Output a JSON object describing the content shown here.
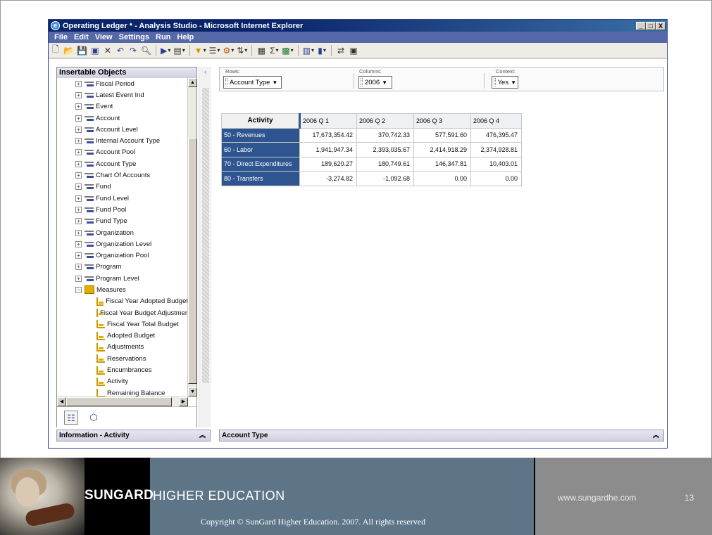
{
  "window": {
    "title": "Operating Ledger * - Analysis Studio - Microsoft Internet Explorer",
    "buttons": [
      "_",
      "□",
      "X"
    ]
  },
  "menu": [
    "File",
    "Edit",
    "View",
    "Settings",
    "Run",
    "Help"
  ],
  "toolbar_icons": [
    "new-icon",
    "open-icon",
    "save-icon",
    "save-as-icon",
    "delete-icon",
    "undo-icon",
    "redo-icon",
    "find-icon",
    "run-icon",
    "layout-icon",
    "filter-icon",
    "suppress-icon",
    "rank-icon",
    "sort-icon",
    "calculation-icon",
    "sum-icon",
    "excel-icon",
    "chart-icon",
    "bar-chart-icon",
    "swap-icon",
    "insert-icon"
  ],
  "left_panel": {
    "title": "Insertable Objects",
    "tree": [
      {
        "label": "Fiscal Period",
        "type": "dimension"
      },
      {
        "label": "Latest Event Ind",
        "type": "dimension"
      },
      {
        "label": "Event",
        "type": "dimension"
      },
      {
        "label": "Account",
        "type": "dimension"
      },
      {
        "label": "Account Level",
        "type": "dimension"
      },
      {
        "label": "Internal Account Type",
        "type": "dimension"
      },
      {
        "label": "Account Pool",
        "type": "dimension"
      },
      {
        "label": "Account Type",
        "type": "dimension"
      },
      {
        "label": "Chart Of Accounts",
        "type": "dimension"
      },
      {
        "label": "Fund",
        "type": "dimension"
      },
      {
        "label": "Fund Level",
        "type": "dimension"
      },
      {
        "label": "Fund Pool",
        "type": "dimension"
      },
      {
        "label": "Fund Type",
        "type": "dimension"
      },
      {
        "label": "Organization",
        "type": "dimension"
      },
      {
        "label": "Organization Level",
        "type": "dimension"
      },
      {
        "label": "Organization Pool",
        "type": "dimension"
      },
      {
        "label": "Program",
        "type": "dimension"
      },
      {
        "label": "Program Level",
        "type": "dimension"
      },
      {
        "label": "Measures",
        "type": "folder"
      },
      {
        "label": "Fiscal Year Adopted Budget",
        "type": "measure"
      },
      {
        "label": "Fiscal Year Budget Adjustments",
        "type": "measure"
      },
      {
        "label": "Fiscal Year Total Budget",
        "type": "measure"
      },
      {
        "label": "Adopted Budget",
        "type": "measure"
      },
      {
        "label": "Adjustments",
        "type": "measure"
      },
      {
        "label": "Reservations",
        "type": "measure"
      },
      {
        "label": "Encumbrances",
        "type": "measure"
      },
      {
        "label": "Activity",
        "type": "measure"
      },
      {
        "label": "Remaining Balance",
        "type": "measure-plain"
      }
    ],
    "info_title": "Information - Activity"
  },
  "dropzones": {
    "rows_label": "Rows:",
    "rows_value": "Account Type",
    "columns_label": "Columns:",
    "columns_value": "2006",
    "context_label": "Context:",
    "context_value": "Yes"
  },
  "crosstab": {
    "corner": "Activity",
    "columns": [
      "2006 Q 1",
      "2006 Q 2",
      "2006 Q 3",
      "2006 Q 4"
    ],
    "rows": [
      {
        "label": "50 - Revenues",
        "values": [
          "17,673,354.42",
          "370,742.33",
          "577,591.60",
          "476,395.47"
        ]
      },
      {
        "label": "60 - Labor",
        "values": [
          "1,941,947.34",
          "2,393,035.67",
          "2,414,918.29",
          "2,374,928.81"
        ]
      },
      {
        "label": "70 - Direct Expenditures",
        "values": [
          "189,620.27",
          "180,749.61",
          "146,347.81",
          "10,403.01"
        ]
      },
      {
        "label": "80 - Transfers",
        "values": [
          "-3,274.82",
          "-1,092.68",
          "0.00",
          "0.00"
        ]
      }
    ]
  },
  "bottom_bar_title": "Account Type",
  "footer": {
    "brand_bold": "SUNGARD",
    "brand_light": "HIGHER EDUCATION",
    "copyright": "Copyright © SunGard Higher Education.  2007.  All rights reserved",
    "url": "www.sungardhe.com",
    "slide_number": "13"
  }
}
